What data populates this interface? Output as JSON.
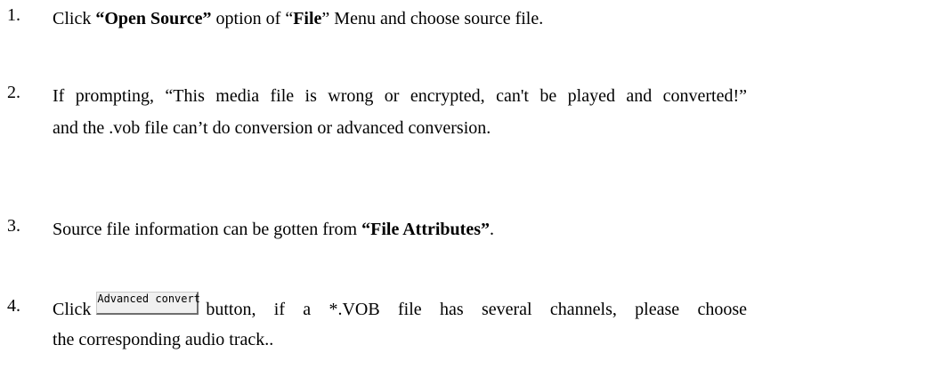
{
  "steps": [
    {
      "number": "1.",
      "parts": {
        "a": "Click ",
        "b": "“Open Source”",
        "c": " option of “",
        "d": "File",
        "e": "” Menu and choose source file."
      }
    },
    {
      "number": "2.",
      "line1": "If prompting, “This media file is wrong or encrypted, can't be played and converted!”",
      "line2": "and the .vob file can’t do conversion or advanced conversion."
    },
    {
      "number": "3.",
      "parts": {
        "a": "Source file information can be gotten from ",
        "b": "“File Attributes”",
        "c": "."
      }
    },
    {
      "number": "4.",
      "pre": "Click",
      "button_label": "Advanced convert",
      "post": "button, if a *.VOB file has several channels, please choose",
      "line2": "the corresponding audio track.."
    }
  ]
}
